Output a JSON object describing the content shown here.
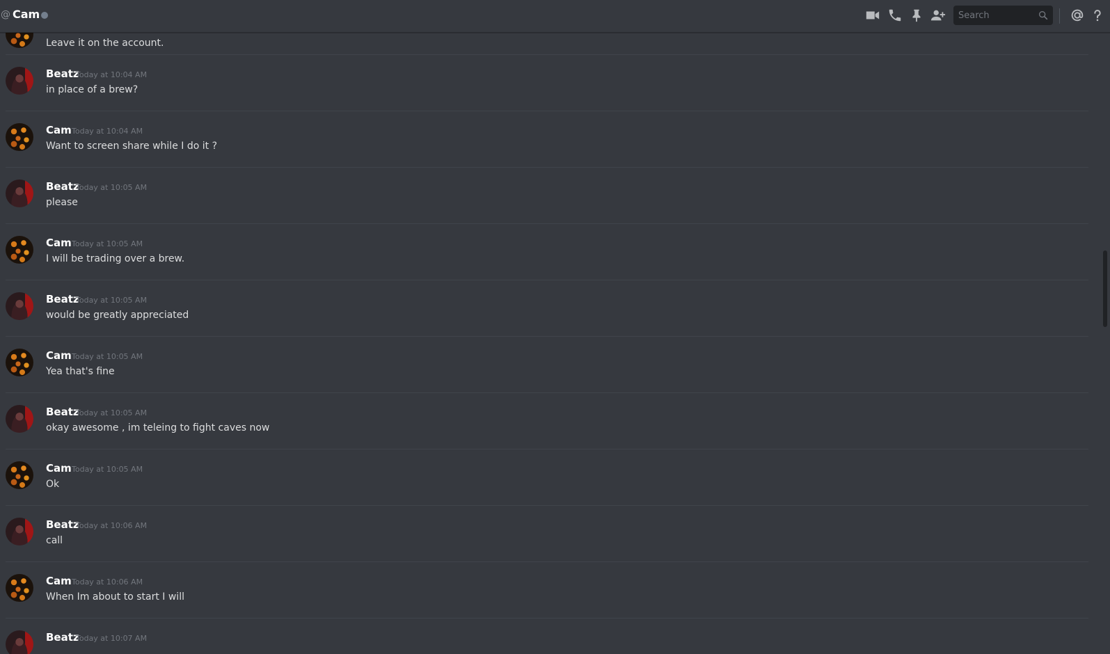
{
  "header": {
    "at_symbol": "@",
    "channel_name": "Cam",
    "search_placeholder": "Search",
    "icons": [
      "video-camera-icon",
      "phone-icon",
      "pin-icon",
      "add-friend-icon",
      "search-icon",
      "mention-icon",
      "help-icon"
    ]
  },
  "colors": {
    "background": "#36393f",
    "divider": "#40444b",
    "username": "#ffffff",
    "timestamp": "#72767d",
    "text": "#dcddde",
    "status_offline": "#747f8d"
  },
  "messages": [
    {
      "author": "",
      "time": "",
      "text": "Leave it on the account."
    },
    {
      "author": "Beatz",
      "time": "Today at 10:04 AM",
      "text": "in place of a brew?"
    },
    {
      "author": "Cam",
      "time": "Today at 10:04 AM",
      "text": "Want to screen share while I do it ?"
    },
    {
      "author": "Beatz",
      "time": "Today at 10:05 AM",
      "text": "please"
    },
    {
      "author": "Cam",
      "time": "Today at 10:05 AM",
      "text": "I will be trading over a brew."
    },
    {
      "author": "Beatz",
      "time": "Today at 10:05 AM",
      "text": "would be greatly appreciated"
    },
    {
      "author": "Cam",
      "time": "Today at 10:05 AM",
      "text": "Yea that's fine"
    },
    {
      "author": "Beatz",
      "time": "Today at 10:05 AM",
      "text": "okay awesome , im teleing to fight caves now"
    },
    {
      "author": "Cam",
      "time": "Today at 10:05 AM",
      "text": "Ok"
    },
    {
      "author": "Beatz",
      "time": "Today at 10:06 AM",
      "text": "call"
    },
    {
      "author": "Cam",
      "time": "Today at 10:06 AM",
      "text": "When Im about to start I will"
    },
    {
      "author": "Beatz",
      "time": "Today at 10:07 AM",
      "text": ""
    }
  ]
}
